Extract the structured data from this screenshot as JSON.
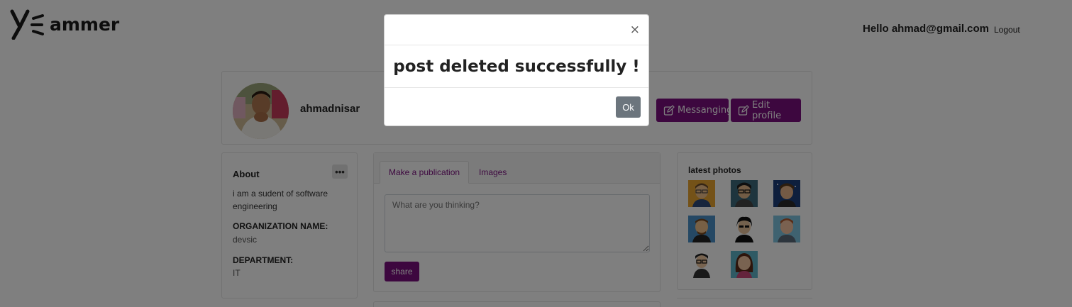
{
  "header": {
    "logo_text": "ammer",
    "greeting": "Hello ahmad@gmail.com",
    "logout_label": "Logout"
  },
  "profile": {
    "username": "ahmadnisar",
    "messaging_label": "Messanging",
    "edit_label": "Edit profile"
  },
  "about": {
    "title": "About",
    "description": "i am a sudent of software engineering",
    "organization_label": "ORGANIZATION NAME:",
    "organization_value": "devsic",
    "department_label": "DEPARTMENT:",
    "department_value": "IT"
  },
  "publication": {
    "tabs": [
      {
        "label": "Make a publication"
      },
      {
        "label": "Images"
      }
    ],
    "placeholder": "What are you thinking?",
    "share_label": "share"
  },
  "photos": {
    "title": "latest photos"
  },
  "modal": {
    "close_glyph": "×",
    "message": "post deleted successfully !",
    "ok_label": "Ok"
  },
  "colors": {
    "brand": "#7b0f7f",
    "ok_button": "#6c757d"
  }
}
